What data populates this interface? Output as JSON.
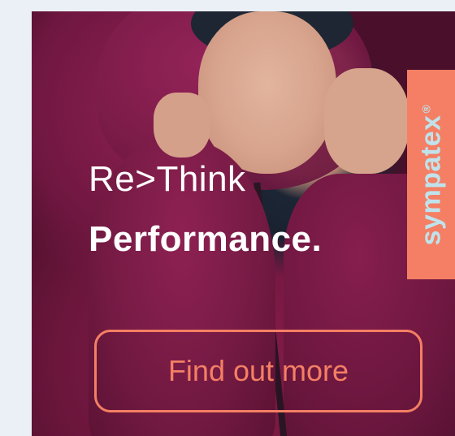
{
  "ad": {
    "headline_line1": "Re>Think",
    "headline_line2": "Performance.",
    "brand": {
      "name": "sympatex",
      "mark": "®"
    },
    "cta_label": "Find out more",
    "colors": {
      "accent": "#f47f64",
      "brand_text": "#bfe3ec",
      "headline": "#ffffff",
      "jacket": "#7a1b47"
    }
  }
}
